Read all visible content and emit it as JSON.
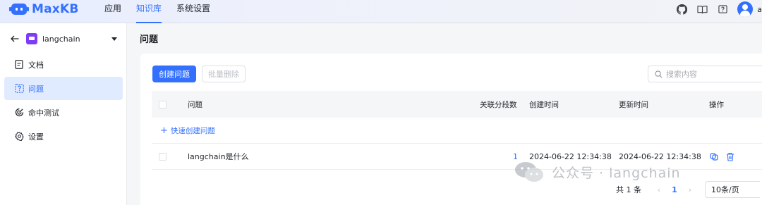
{
  "app": {
    "name": "MaxKB"
  },
  "topnav": {
    "items": [
      {
        "label": "应用"
      },
      {
        "label": "知识库"
      },
      {
        "label": "系统设置"
      }
    ],
    "active": 1
  },
  "user": {
    "name": "a"
  },
  "sidebar": {
    "kb_name": "langchain",
    "items": [
      {
        "label": "文档"
      },
      {
        "label": "问题"
      },
      {
        "label": "命中测试"
      },
      {
        "label": "设置"
      }
    ],
    "active": 1
  },
  "page": {
    "title": "问题"
  },
  "toolbar": {
    "create_label": "创建问题",
    "batch_delete_label": "批量删除",
    "search_placeholder": "搜索内容"
  },
  "table": {
    "headers": {
      "question": "问题",
      "count": "关联分段数",
      "created": "创建时间",
      "updated": "更新时间",
      "ops": "操作"
    },
    "quick_add_label": "快速创建问题",
    "rows": [
      {
        "question": "langchain是什么",
        "count": "1",
        "created": "2024-06-22 12:34:38",
        "updated": "2024-06-22 12:34:38"
      }
    ]
  },
  "pagination": {
    "total_text": "共 1 条",
    "current_page": "1",
    "page_size": "10条/页"
  },
  "watermark": {
    "text": "公众号 · langchain"
  },
  "colors": {
    "primary": "#3370ff",
    "kb_icon": "#7f3bf5",
    "active_bg": "#e1ebff"
  }
}
